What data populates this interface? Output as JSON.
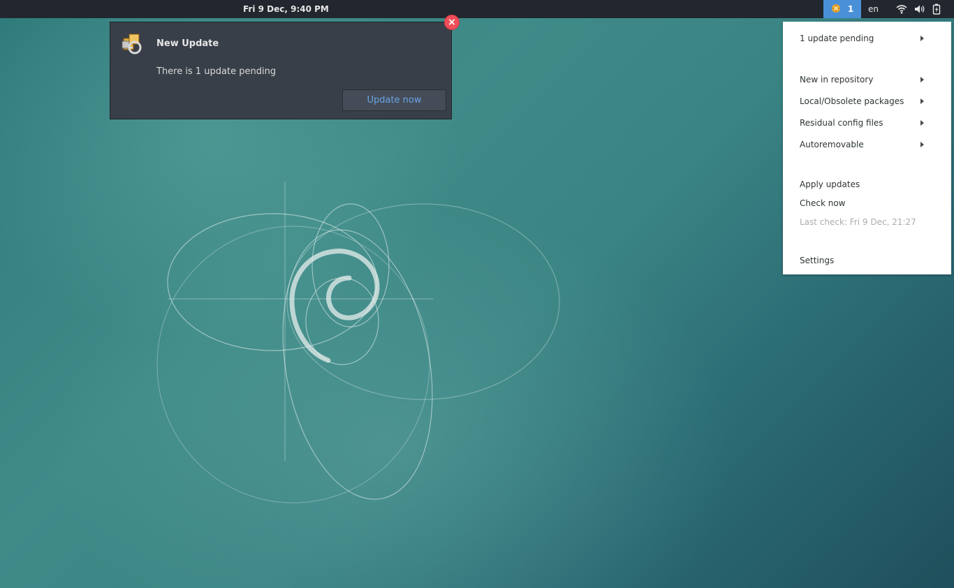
{
  "topbar": {
    "clock": "Fri  9 Dec,  9:40 PM",
    "update_indicator_count": "1",
    "language": "en",
    "tray_icons": [
      "wifi-icon",
      "volume-icon",
      "battery-icon"
    ]
  },
  "notification": {
    "title": "New Update",
    "body": "There is 1 update pending",
    "button_label": "Update now",
    "close_glyph": "×",
    "icon": "package-update-icon"
  },
  "menu": {
    "items": [
      {
        "label": "1 update pending",
        "submenu": true
      },
      {
        "label": "New in repository",
        "submenu": true
      },
      {
        "label": "Local/Obsolete packages",
        "submenu": true
      },
      {
        "label": "Residual config files",
        "submenu": true
      },
      {
        "label": "Autoremovable",
        "submenu": true
      },
      {
        "label": "Apply updates",
        "submenu": false
      },
      {
        "label": "Check now",
        "submenu": false
      },
      {
        "label": "Last check: Fri 9 Dec, 21:27",
        "submenu": false,
        "disabled": true
      },
      {
        "label": "Settings",
        "submenu": false
      }
    ]
  },
  "colors": {
    "topbar_bg": "#22262e",
    "indicator_active": "#4a90d9",
    "notification_bg": "#393f48",
    "button_text": "#6aa4e6",
    "close_red": "#ef4f5a"
  }
}
